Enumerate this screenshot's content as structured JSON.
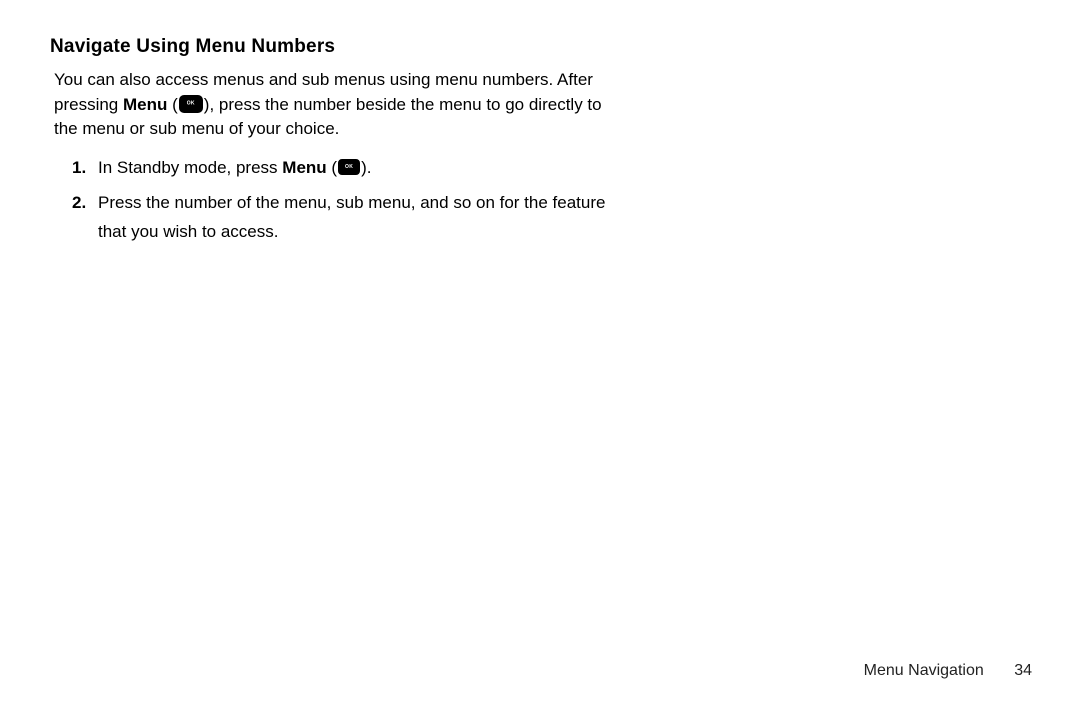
{
  "heading": "Navigate Using Menu Numbers",
  "intro": {
    "pre": "You can also access menus and sub menus using menu numbers. After pressing ",
    "menu_word": "Menu",
    "mid": ", press the number beside the menu to go directly to the menu or sub menu of your choice.",
    "ok_icon": "ok-key"
  },
  "steps": [
    {
      "num": "1.",
      "pre": "In Standby mode, press ",
      "menu_word": "Menu",
      "post": ".",
      "has_icon": true
    },
    {
      "num": "2.",
      "pre": "Press the number of the menu, sub menu, and so on for the feature that you wish to access.",
      "menu_word": "",
      "post": "",
      "has_icon": false
    }
  ],
  "footer": {
    "section": "Menu Navigation",
    "page": "34"
  }
}
